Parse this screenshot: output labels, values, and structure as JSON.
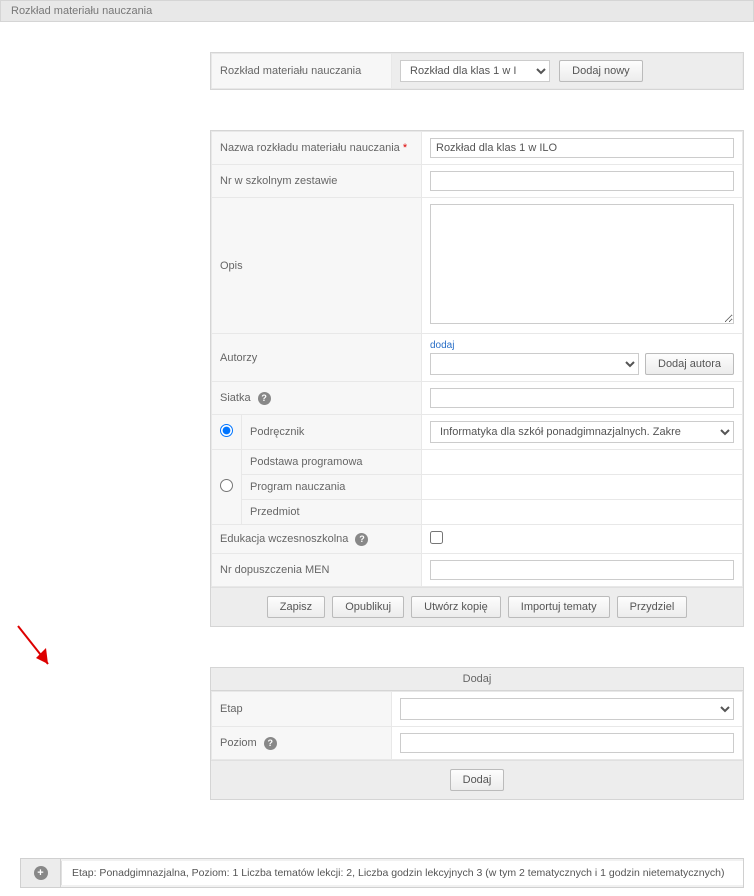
{
  "pageHeader": "Rozkład materiału nauczania",
  "topBar": {
    "label": "Rozkład materiału nauczania",
    "selectValue": "Rozkład dla klas 1 w I",
    "addBtn": "Dodaj nowy"
  },
  "form": {
    "nameLabel": "Nazwa rozkładu materiału nauczania",
    "nameValue": "Rozkład dla klas 1 w ILO",
    "setNoLabel": "Nr w szkolnym zestawie",
    "setNoValue": "",
    "descLabel": "Opis",
    "descValue": "",
    "authorsLabel": "Autorzy",
    "authorsAddLink": "dodaj",
    "authorsBtn": "Dodaj autora",
    "gridLabel": "Siatka",
    "textbookLabel": "Podręcznik",
    "textbookValue": "Informatyka dla szkół ponadgimnazjalnych. Zakre",
    "coreLabel": "Podstawa programowa",
    "programLabel": "Program nauczania",
    "subjectLabel": "Przedmiot",
    "earlyEduLabel": "Edukacja wczesnoszkolna",
    "menLabel": "Nr dopuszczenia MEN",
    "menValue": ""
  },
  "actions": {
    "save": "Zapisz",
    "publish": "Opublikuj",
    "copy": "Utwórz kopię",
    "import": "Importuj tematy",
    "assign": "Przydziel"
  },
  "addPanel": {
    "title": "Dodaj",
    "stageLabel": "Etap",
    "levelLabel": "Poziom",
    "addBtn": "Dodaj"
  },
  "etapSummary": "Etap: Ponadgimnazjalna, Poziom: 1 Liczba tematów lekcji: 2, Liczba godzin lekcyjnych 3 (w tym 2 tematycznych i 1 godzin nietematycznych)"
}
